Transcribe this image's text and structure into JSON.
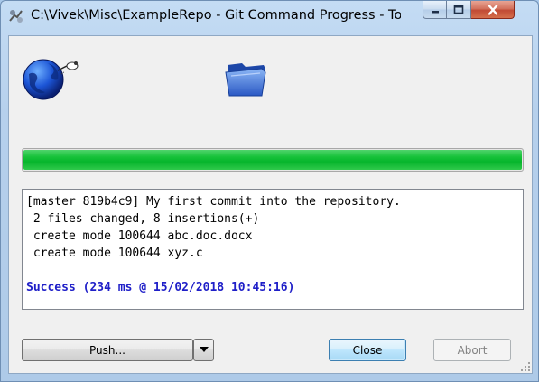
{
  "window": {
    "title": "C:\\Vivek\\Misc\\ExampleRepo - Git Command Progress - TortoiseGit"
  },
  "progress": {
    "percent": 100,
    "color": "#06b52c"
  },
  "output": {
    "lines": [
      "[master 819b4c9] My first commit into the repository.",
      " 2 files changed, 8 insertions(+)",
      " create mode 100644 abc.doc.docx",
      " create mode 100644 xyz.c",
      ""
    ],
    "success_line": "Success (234 ms @ 15/02/2018 10:45:16)",
    "success_color": "#1f1fc8"
  },
  "buttons": {
    "push_label": "Push...",
    "close_label": "Close",
    "abort_label": "Abort"
  },
  "icons": {
    "app": "tortoisegit-icon",
    "animation_left": "globe-icon",
    "animation_right": "folder-icon"
  }
}
